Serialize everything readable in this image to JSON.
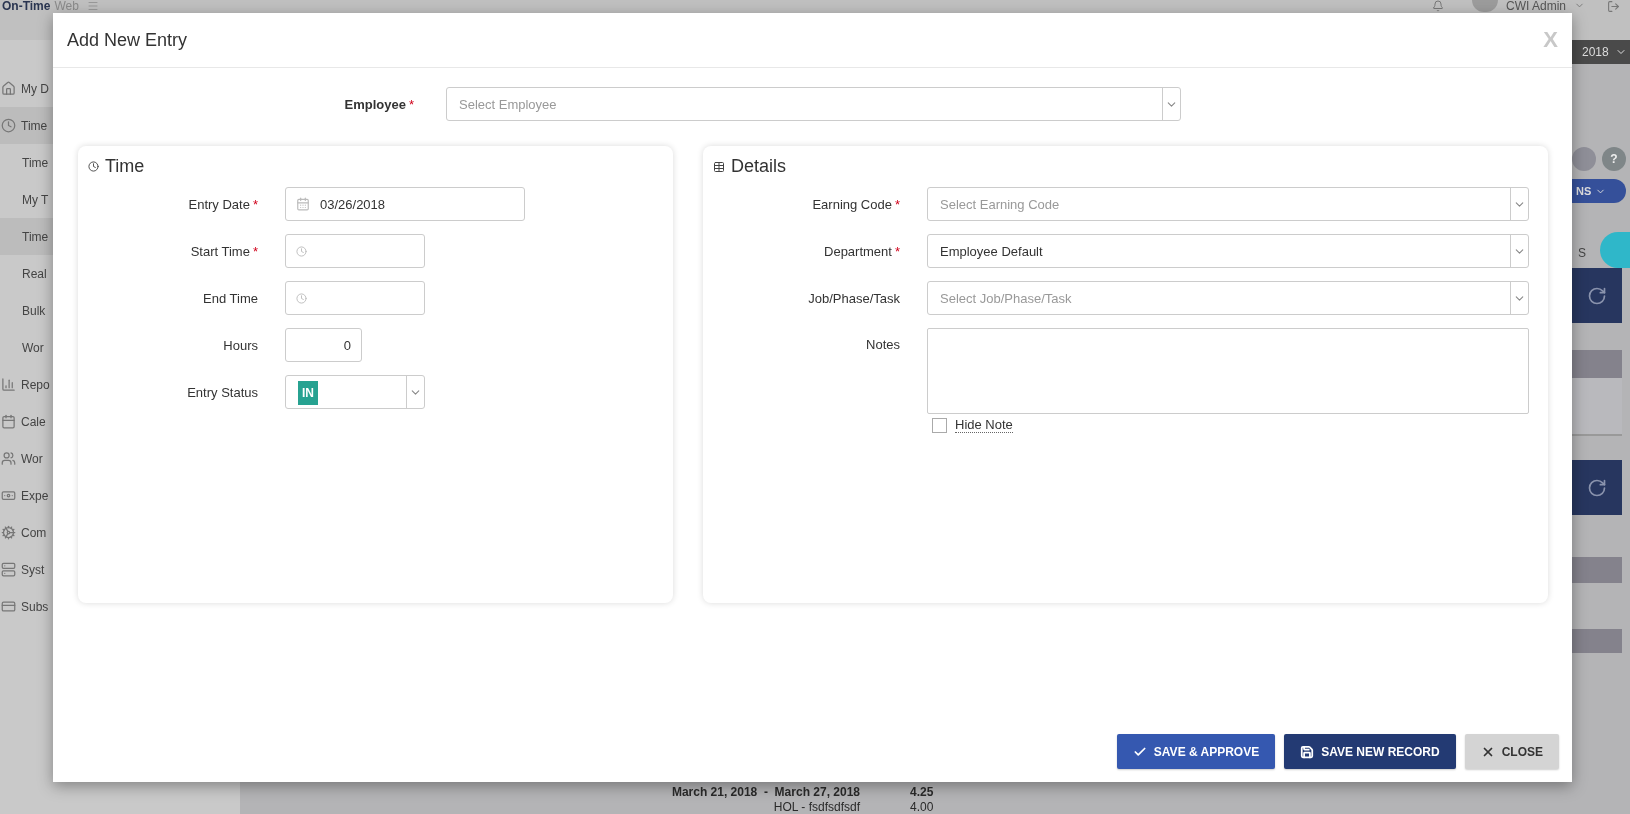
{
  "app": {
    "logo": {
      "name": "On-Time",
      "suffix": "Web"
    },
    "user": "CWI Admin",
    "period": "2018",
    "help": "?",
    "actions_button": "NS",
    "column_header": "S",
    "sidebar": {
      "items": [
        {
          "label": "My D",
          "selected": false
        },
        {
          "label": "Time",
          "selected": true,
          "children": [
            {
              "label": "Time",
              "selected": false
            },
            {
              "label": "My T",
              "selected": false
            },
            {
              "label": "Time",
              "selected": true
            },
            {
              "label": "Real",
              "selected": false
            },
            {
              "label": "Bulk",
              "selected": false
            },
            {
              "label": "Wor",
              "selected": false
            }
          ]
        },
        {
          "label": "Repo",
          "selected": false
        },
        {
          "label": "Cale",
          "selected": false
        },
        {
          "label": "Wor",
          "selected": false
        },
        {
          "label": "Expe",
          "selected": false
        },
        {
          "label": "Com",
          "selected": false
        },
        {
          "label": "Syst",
          "selected": false
        },
        {
          "label": "Subs",
          "selected": false
        }
      ]
    },
    "summary": {
      "range": "March 21, 2018  -  March 27, 2018",
      "total": "4.25",
      "rows": [
        {
          "label": "HOL - fsdfsdfsdf",
          "hours": "4.00"
        }
      ]
    }
  },
  "dialog": {
    "title": "Add New Entry",
    "close": "X",
    "employee": {
      "label": "Employee",
      "required_mark": "*",
      "placeholder": "Select Employee"
    },
    "time_panel": {
      "title": "Time",
      "fields": [
        {
          "kind": "date",
          "label": "Entry Date",
          "required_mark": "*",
          "value": "03/26/2018"
        },
        {
          "kind": "time",
          "label": "Start Time",
          "required_mark": "*"
        },
        {
          "kind": "time",
          "label": "End Time"
        },
        {
          "kind": "number",
          "label": "Hours",
          "value": "0"
        },
        {
          "kind": "status",
          "label": "Entry Status",
          "value": "IN"
        }
      ]
    },
    "details_panel": {
      "title": "Details",
      "fields": [
        {
          "kind": "select",
          "label": "Earning Code",
          "required_mark": "*",
          "placeholder": "Select Earning Code"
        },
        {
          "kind": "select",
          "label": "Department",
          "required_mark": "*",
          "value": "Employee Default"
        },
        {
          "kind": "select",
          "label": "Job/Phase/Task",
          "placeholder": "Select Job/Phase/Task"
        },
        {
          "kind": "textarea",
          "label": "Notes"
        }
      ],
      "hide_note": {
        "label": "Hide Note",
        "checked": false
      }
    },
    "buttons": [
      {
        "kind": "approve",
        "label": "SAVE & APPROVE"
      },
      {
        "kind": "save",
        "label": "SAVE NEW RECORD"
      },
      {
        "kind": "close",
        "label": "CLOSE"
      }
    ]
  }
}
